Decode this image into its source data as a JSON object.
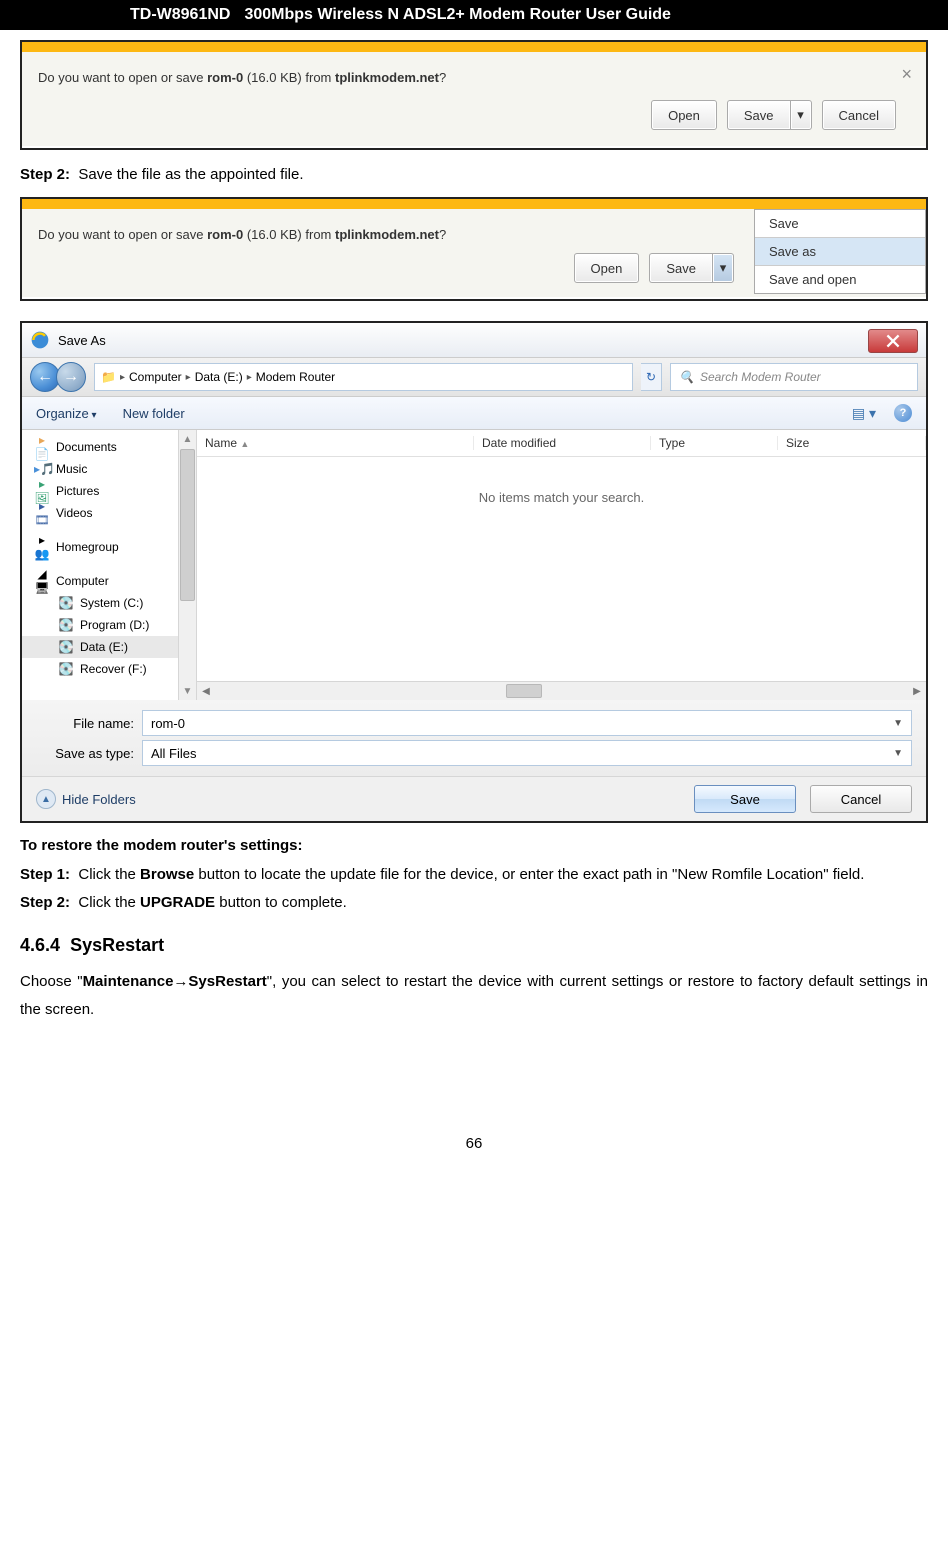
{
  "header": {
    "model": "TD-W8961ND",
    "title": "300Mbps Wireless N ADSL2+ Modem Router User Guide"
  },
  "prompt": {
    "pre": "Do you want to open or save ",
    "file": "rom-0",
    "size": " (16.0 KB) from ",
    "host": "tplinkmodem.net",
    "q": "?",
    "open": "Open",
    "save": "Save",
    "cancel": "Cancel",
    "arrow": "▾"
  },
  "step2": {
    "label": "Step 2:",
    "text": "Save the file as the appointed file."
  },
  "menu": {
    "save": "Save",
    "saveas": "Save as",
    "saveopen": "Save and open"
  },
  "saveas": {
    "title": "Save As",
    "breadcrumb": {
      "b1": "Computer",
      "b2": "Data (E:)",
      "b3": "Modem Router"
    },
    "searchPH": "Search Modem Router",
    "organize": "Organize",
    "newfolder": "New folder",
    "side": {
      "docs": "Documents",
      "music": "Music",
      "pics": "Pictures",
      "videos": "Videos",
      "home": "Homegroup",
      "comp": "Computer",
      "c": "System (C:)",
      "d": "Program (D:)",
      "e": "Data (E:)",
      "f": "Recover (F:)"
    },
    "cols": {
      "name": "Name",
      "date": "Date modified",
      "type": "Type",
      "size": "Size"
    },
    "nomatch": "No items match your search.",
    "fnlabel": "File name:",
    "filename": "rom-0",
    "typelabel": "Save as type:",
    "filetype": "All Files",
    "hide": "Hide Folders",
    "save": "Save",
    "cancel": "Cancel"
  },
  "restore": {
    "title": "To restore the modem router's settings:",
    "s1label": "Step 1:",
    "s1a": "Click the ",
    "s1b": "Browse",
    "s1c": " button to locate the update file for the device, or enter the exact path in \"New Romfile Location\" field.",
    "s2label": "Step 2:",
    "s2a": "Click the ",
    "s2b": "UPGRADE",
    "s2c": " button to complete."
  },
  "section": {
    "num": "4.6.4",
    "title": "SysRestart",
    "p1": "Choose \"",
    "p2": "Maintenance→SysRestart",
    "p3": "\", you can select to restart the device with current settings or restore to factory default settings in the screen."
  },
  "pagenum": "66"
}
